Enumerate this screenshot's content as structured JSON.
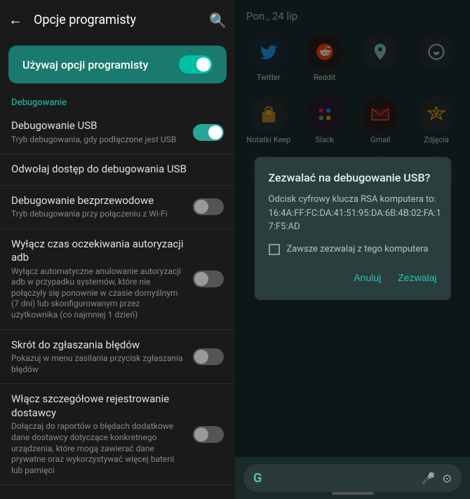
{
  "leftPanel": {
    "header": {
      "title": "Opcje programisty",
      "backIcon": "←",
      "searchIcon": "🔍"
    },
    "mainToggle": {
      "label": "Używaj opcji programisty",
      "state": "on"
    },
    "sectionLabel": "Debugowanie",
    "items": [
      {
        "id": "usb-debug",
        "title": "Debugowanie USB",
        "subtitle": "Tryb debugowania, gdy podłączone jest USB",
        "hasToggle": true,
        "toggleState": "on"
      },
      {
        "id": "revoke-usb",
        "title": "Odwołaj dostęp do debugowania USB",
        "subtitle": "",
        "hasToggle": false,
        "toggleState": null
      },
      {
        "id": "wireless-debug",
        "title": "Debugowanie bezprzewodowe",
        "subtitle": "Tryb debugowania przy połączeniu z Wi-Fi",
        "hasToggle": true,
        "toggleState": "off"
      },
      {
        "id": "adb-auth",
        "title": "Wyłącz czas oczekiwania autoryzacji adb",
        "subtitle": "Wyłącz automatyczne anulowanie autoryzacji adb w przypadku systemów, które nie połączyły się ponownie w czasie domyślnym (7 dni) lub skonfigurowanym przez użytkownika (co najmniej 1 dzień)",
        "hasToggle": true,
        "toggleState": "off"
      },
      {
        "id": "bug-shortcut",
        "title": "Skrót do zgłaszania błędów",
        "subtitle": "Pokazuj w menu zasilania przycisk zgłaszania błędów",
        "hasToggle": true,
        "toggleState": "off"
      },
      {
        "id": "vendor-logging",
        "title": "Włącz szczegółowe rejestrowanie dostawcy",
        "subtitle": "Dołączaj do raportów o błędach dodatkowe dane dostawcy dotyczące konkretnego urządzenia, które mogą zawierać dane prywatne oraz wykorzystywać więcej baterii lub pamięci",
        "hasToggle": true,
        "toggleState": "off"
      }
    ]
  },
  "rightPanel": {
    "date": "Pon., 24 lip",
    "apps": [
      {
        "id": "twitter",
        "label": "Twitter",
        "icon": "twitter",
        "color": "#1da1f2"
      },
      {
        "id": "reddit",
        "label": "Reddit",
        "icon": "reddit",
        "color": "#ff4500"
      },
      {
        "id": "app3",
        "label": "",
        "icon": "generic1",
        "color": "#4caf50"
      },
      {
        "id": "app4",
        "label": "",
        "icon": "generic2",
        "color": "#9c27b0"
      }
    ],
    "apps2": [
      {
        "id": "keep",
        "label": "Notatki Keep",
        "icon": "keep",
        "color": "#f9a825"
      },
      {
        "id": "slack",
        "label": "Slack",
        "icon": "slack",
        "color": "#4a154b"
      },
      {
        "id": "gmail",
        "label": "Gmail",
        "icon": "gmail",
        "color": "#d93025"
      },
      {
        "id": "photos",
        "label": "Zdjęcia",
        "icon": "photos",
        "color": "#fbbc04"
      }
    ],
    "apps3": [
      {
        "id": "phone",
        "label": "",
        "icon": "phone",
        "color": "#4caf50"
      },
      {
        "id": "messages",
        "label": "",
        "icon": "messages",
        "color": "#26a69a"
      },
      {
        "id": "chrome",
        "label": "",
        "icon": "chrome",
        "color": "#4285f4"
      },
      {
        "id": "camera",
        "label": "",
        "icon": "camera",
        "color": "#e0e0e0"
      }
    ],
    "dialog": {
      "title": "Zezwalać na debugowanie USB?",
      "body": "Odcisk cyfrowy klucza RSA komputera to: 16:4A:FF:FC:DA:41:51:95:DA:6B:4B:02:FA:1 7:F5:AD",
      "checkboxLabel": "Zawsze zezwalaj z tego komputera",
      "cancelLabel": "Anuluj",
      "allowLabel": "Zezwalaj"
    },
    "bottomBar": {
      "googleIcon": "G",
      "micIcon": "🎤",
      "lensIcon": "⊙"
    }
  }
}
